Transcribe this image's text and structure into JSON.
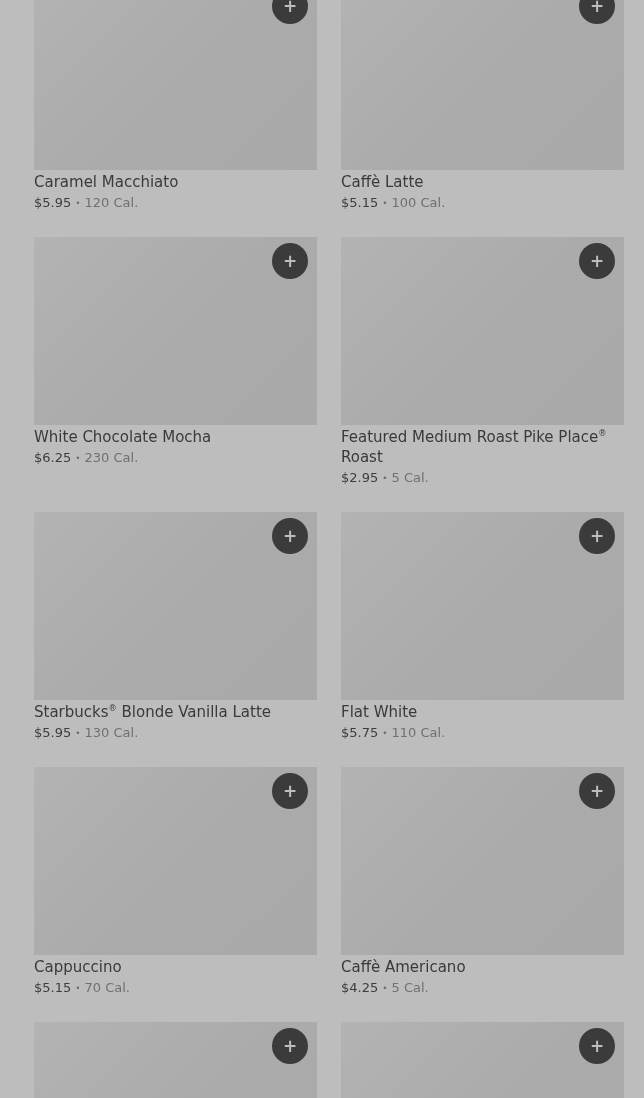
{
  "items": [
    {
      "name": "Caramel Macchiato",
      "price": "$5.95",
      "separator": "•",
      "calories": "120 Cal.",
      "add": "+"
    },
    {
      "name": "Caffè Latte",
      "price": "$5.15",
      "separator": "•",
      "calories": "100 Cal.",
      "add": "+"
    },
    {
      "name": "White Chocolate Mocha",
      "price": "$6.25",
      "separator": "•",
      "calories": "230 Cal.",
      "add": "+"
    },
    {
      "name": "Featured Medium Roast Pike Place$^{®}$ Roast",
      "price": "$2.95",
      "separator": "•",
      "calories": "5 Cal.",
      "add": "+"
    },
    {
      "name": "Starbucks$^{®}$ Blonde Vanilla Latte",
      "price": "$5.95",
      "separator": "•",
      "calories": "130 Cal.",
      "add": "+"
    },
    {
      "name": "Flat White",
      "price": "$5.75",
      "separator": "•",
      "calories": "110 Cal.",
      "add": "+"
    },
    {
      "name": "Cappuccino",
      "price": "$5.15",
      "separator": "•",
      "calories": "70 Cal.",
      "add": "+"
    },
    {
      "name": "Caffè Americano",
      "price": "$4.25",
      "separator": "•",
      "calories": "5 Cal.",
      "add": "+"
    },
    {
      "add": "+"
    },
    {
      "add": "+"
    }
  ]
}
